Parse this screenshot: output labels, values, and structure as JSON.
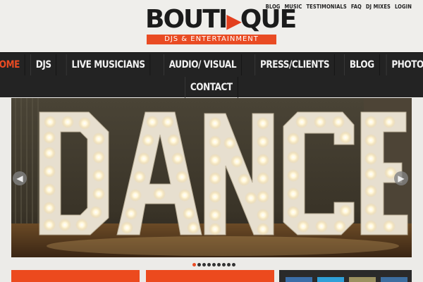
{
  "logo": {
    "word_pre": "BOUTI",
    "word_play": "▶",
    "word_post": "QUE",
    "tagline": "DJS & ENTERTAINMENT"
  },
  "top_links": [
    "BLOG",
    "MUSIC",
    "TESTIMONIALS",
    "FAQ",
    "DJ MIXES",
    "LOGIN"
  ],
  "nav": {
    "row1": [
      "HOME",
      "DJS",
      "LIVE MUSICIANS",
      "AUDIO/ VISUAL",
      "PRESS/CLIENTS",
      "BLOG",
      "PHOTOS"
    ],
    "row2": [
      "CONTACT"
    ],
    "active": "HOME"
  },
  "slider": {
    "sign_text": "DANCE",
    "prev_icon": "chevron-left-icon",
    "next_icon": "chevron-right-icon",
    "slide_count": 9,
    "active_slide": 1
  },
  "colors": {
    "accent": "#e94b23",
    "nav_bg": "#232323",
    "page_bg": "#ecebe8"
  }
}
